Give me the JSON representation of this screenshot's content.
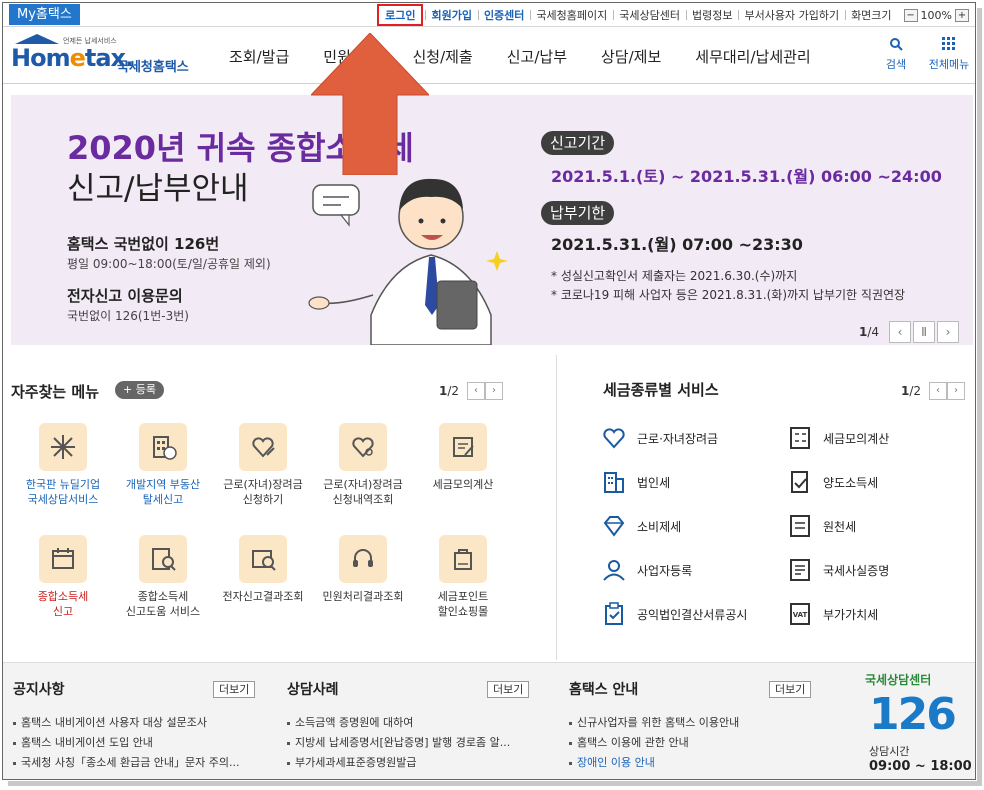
{
  "topbar": {
    "my_home": "My홈택스",
    "links": [
      "로그인",
      "회원가입",
      "인증센터",
      "국세청홈페이지",
      "국세상담센터",
      "법령정보",
      "부서사용자 가입하기",
      "화면크기"
    ],
    "zoom_minus": "−",
    "zoom_level": "100%",
    "zoom_plus": "+"
  },
  "header": {
    "logo_small": "언제든 납세서비스",
    "logo_home": "Hom",
    "logo_e": "e",
    "logo_tax": "tax.",
    "logo_sub": "국세청홈택스",
    "nav": [
      "조회/발급",
      "민원증명",
      "신청/제출",
      "신고/납부",
      "상담/제보",
      "세무대리/납세관리"
    ],
    "search_icon": "search-icon",
    "search_label": "검색",
    "menu_icon": "grid-icon",
    "menu_label": "전체메뉴"
  },
  "banner": {
    "title1": "2020년 귀속 종합소득세",
    "title2": "신고/납부안내",
    "help1": "홈택스 국번없이 126번",
    "help1_sub": "평일 09:00~18:00(토/일/공휴일 제외)",
    "help2": "전자신고 이용문의",
    "help2_sub": "국번없이 126(1번-3번)",
    "period1_label": "신고기간",
    "period1_date": "2021.5.1.(토) ~ 2021.5.31.(월) 06:00 ~24:00",
    "period2_label": "납부기한",
    "period2_date": "2021.5.31.(월) 07:00 ~23:30",
    "note1": "* 성실신고확인서 제출자는 2021.6.30.(수)까지",
    "note2": "* 코로나19 피해 사업자 등은 2021.8.31.(화)까지 납부기한 직권연장",
    "page_current": "1",
    "page_total": "/4",
    "prev": "‹",
    "pause": "Ⅱ",
    "next": "›"
  },
  "favorites": {
    "title": "자주찾는 메뉴",
    "add_label": "+ 등록",
    "page_current": "1",
    "page_total": "/2",
    "prev": "‹",
    "next": "›",
    "items": [
      {
        "l1": "한국판 뉴딜기업",
        "l2": "국세상담서비스",
        "icon": "sparkle-icon"
      },
      {
        "l1": "개발지역 부동산",
        "l2": "탈세신고",
        "icon": "building-icon"
      },
      {
        "l1": "근로(자녀)장려금",
        "l2": "신청하기",
        "icon": "heart-pen-icon"
      },
      {
        "l1": "근로(자녀)장려금",
        "l2": "신청내역조회",
        "icon": "heart-search-icon"
      },
      {
        "l1": "세금모의계산",
        "l2": "",
        "icon": "calculator-doc-icon"
      },
      {
        "l1": "종합소득세",
        "l2": "신고",
        "icon": "calendar-icon"
      },
      {
        "l1": "종합소득세",
        "l2": "신고도움 서비스",
        "icon": "doc-search-icon"
      },
      {
        "l1": "전자신고결과조회",
        "l2": "",
        "icon": "won-search-icon"
      },
      {
        "l1": "민원처리결과조회",
        "l2": "",
        "icon": "headset-icon"
      },
      {
        "l1": "세금포인트",
        "l2": "할인쇼핑몰",
        "icon": "tax-bag-icon"
      }
    ]
  },
  "tax_services": {
    "title": "세금종류별 서비스",
    "page_current": "1",
    "page_total": "/2",
    "prev": "‹",
    "next": "›",
    "items": [
      {
        "label": "근로·자녀장려금",
        "icon": "heart-icon"
      },
      {
        "label": "세금모의계산",
        "icon": "calculator-icon"
      },
      {
        "label": "법인세",
        "icon": "office-building-icon"
      },
      {
        "label": "양도소득세",
        "icon": "transfer-doc-icon"
      },
      {
        "label": "소비제세",
        "icon": "diamond-icon"
      },
      {
        "label": "원천세",
        "icon": "salary-doc-icon"
      },
      {
        "label": "사업자등록",
        "icon": "person-icon"
      },
      {
        "label": "국세사실증명",
        "icon": "certificate-icon"
      },
      {
        "label": "공익법인결산서류공시",
        "icon": "clipboard-icon"
      },
      {
        "label": "부가가치세",
        "icon": "vat-icon"
      }
    ]
  },
  "notice": {
    "title": "공지사항",
    "more": "더보기",
    "items": [
      "홈택스 내비게이션 사용자 대상 설문조사",
      "홈택스 내비게이션 도입 안내",
      "국세청 사칭「종소세 환급금 안내」문자 주의..."
    ]
  },
  "cases": {
    "title": "상담사례",
    "more": "더보기",
    "items": [
      "소득금액 증명원에 대하여",
      "지방세 납세증명서[완납증명] 발행 경로좀 알...",
      "부가세과세표준증명원발급"
    ]
  },
  "guide": {
    "title": "홈택스 안내",
    "more": "더보기",
    "items": [
      "신규사업자를 위한 홈택스 이용안내",
      "홈택스 이용에 관한 안내",
      "장애인 이용 안내"
    ]
  },
  "center126": {
    "title": "국세상담센터",
    "number": "126",
    "hours_label": "상담시간",
    "hours": "09:00 ~ 18:00"
  }
}
